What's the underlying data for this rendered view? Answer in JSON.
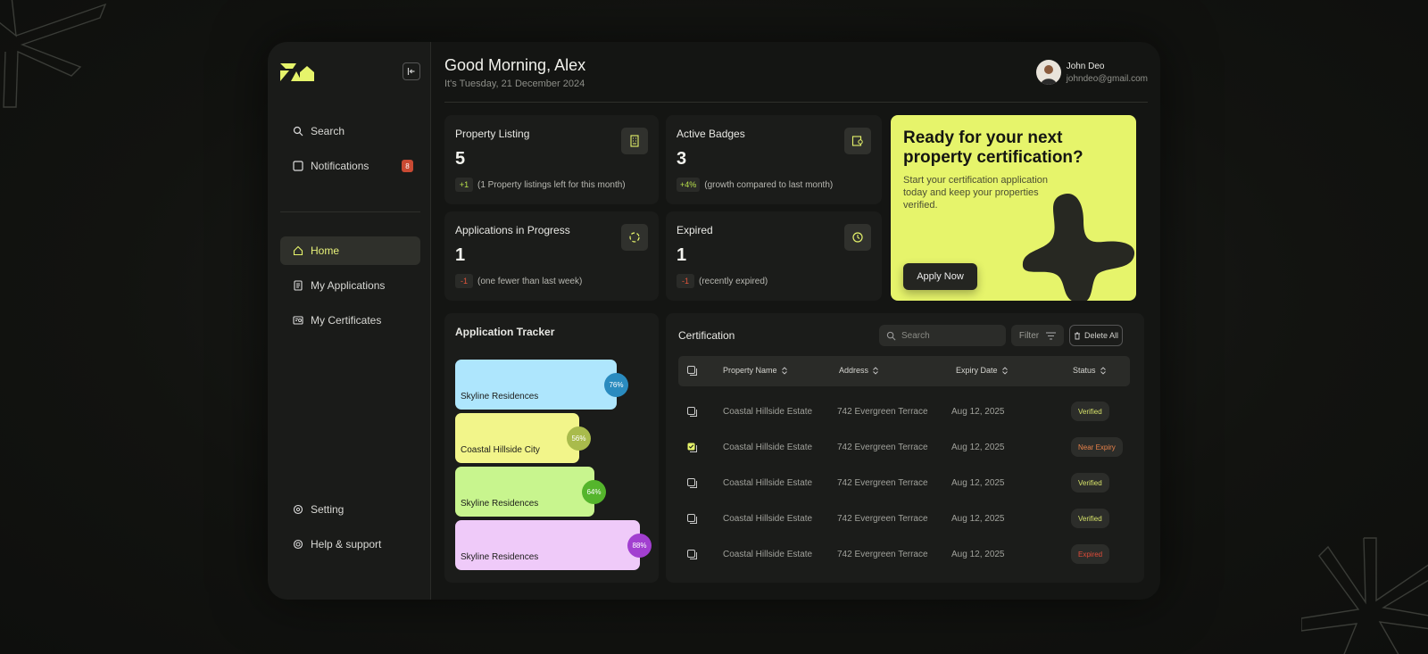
{
  "colors": {
    "accent": "#e6f46b",
    "bar_blue": "#aee6fd",
    "bar_yellow": "#f2f58a",
    "bar_green": "#c8f58e",
    "bar_pink": "#efcaf9",
    "badge_blue": "#2a8bbf",
    "badge_olive": "#a9bb4c",
    "badge_green": "#55b52c",
    "badge_purple": "#a23fd0"
  },
  "sidebar": {
    "search": "Search",
    "notifications": "Notifications",
    "notifications_count": "8",
    "home": "Home",
    "my_applications": "My Applications",
    "my_certificates": "My Certificates",
    "setting": "Setting",
    "help": "Help & support"
  },
  "header": {
    "greeting": "Good Morning, Alex",
    "date": "It's Tuesday, 21 December 2024",
    "user_name": "John Deo",
    "user_email": "johndeo@gmail.com"
  },
  "stats": [
    {
      "title": "Property Listing",
      "value": "5",
      "chip": "+1",
      "note": "(1 Property listings left for this month)",
      "icon": "building-icon"
    },
    {
      "title": "Active Badges",
      "value": "3",
      "chip": "+4%",
      "note": "(growth compared to last month)",
      "icon": "badge-icon"
    },
    {
      "title": "Applications in Progress",
      "value": "1",
      "chip": "-1",
      "note": "(one fewer than last week)",
      "icon": "progress-icon"
    },
    {
      "title": "Expired",
      "value": "1",
      "chip": "-1",
      "note": "(recently expired)",
      "icon": "expired-clock-icon"
    }
  ],
  "promo": {
    "title": "Ready for your next property certification?",
    "subtitle": "Start your certification application today and keep your properties verified.",
    "button": "Apply Now"
  },
  "tracker": {
    "title": "Application Tracker",
    "items": [
      {
        "label": "Skyline Residences",
        "percent": "76%",
        "value": 76
      },
      {
        "label": "Coastal Hillside City",
        "percent": "56%",
        "value": 56
      },
      {
        "label": "Skyline Residences",
        "percent": "64%",
        "value": 64
      },
      {
        "label": "Skyline Residences",
        "percent": "88%",
        "value": 88
      }
    ]
  },
  "certification": {
    "title": "Certification",
    "search_placeholder": "Search",
    "filter": "Filter",
    "delete_all": "Delete All",
    "columns": [
      "Property Name",
      "Address",
      "Expiry Date",
      "Status"
    ],
    "rows": [
      {
        "name": "Coastal Hillside Estate",
        "address": "742 Evergreen Terrace",
        "expiry": "Aug 12, 2025",
        "status": "Verified",
        "checked": false
      },
      {
        "name": "Coastal Hillside Estate",
        "address": "742 Evergreen Terrace",
        "expiry": "Aug 12, 2025",
        "status": "Near Expiry",
        "checked": true
      },
      {
        "name": "Coastal Hillside Estate",
        "address": "742 Evergreen Terrace",
        "expiry": "Aug 12, 2025",
        "status": "Verified",
        "checked": false
      },
      {
        "name": "Coastal Hillside Estate",
        "address": "742 Evergreen Terrace",
        "expiry": "Aug 12, 2025",
        "status": "Verified",
        "checked": false
      },
      {
        "name": "Coastal Hillside Estate",
        "address": "742 Evergreen Terrace",
        "expiry": "Aug 12, 2025",
        "status": "Expired",
        "checked": false
      }
    ]
  }
}
